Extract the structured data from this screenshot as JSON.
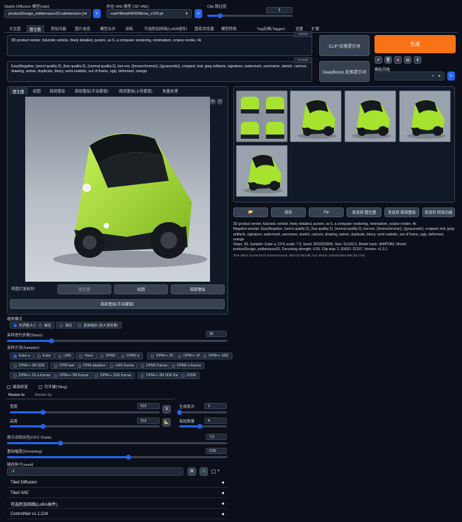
{
  "header": {
    "model_label": "Stable Diffusion 模型(ckpt)",
    "model_value": "productDesign_eddiemauro20.safetensors [db5",
    "vae_label": "外挂 VAE 模型 (SD VAE)",
    "vae_value": "vaeFtMse840000Ema_v100.pt",
    "clip_label": "Clip 跳过层",
    "clip_value": "2",
    "clip_fraction": 0.15
  },
  "tabs": [
    "文生图",
    "图生图",
    "附加功能",
    "图片信息",
    "模型合并",
    "训练",
    "可选附加网络(LoRA插件)",
    "图库浏览器",
    "模型转换",
    "Tag反推(Tagger)",
    "设置",
    "扩展"
  ],
  "active_tab": 1,
  "prompt": {
    "positive": "3D product render, futuristic vehicle, finely detailed, purism, ue 5, a computer rendering, minimalism, octane render, 4k",
    "positive_count": "12/150",
    "negative": "EasyNegative, (worst quality:2), (low quality:2), (normal quality:2), low-res, ((monochrome)), ((grayscale)), cropped, text, jpeg artifacts, signature, watermark, username, sketch, cartoon, drawing, anime, duplicate, blurry, semi-realistic, out of frame, ugly, deformed, orange",
    "negative_count": "57/150"
  },
  "actions": {
    "clip_btn": "CLIP 反推提示词",
    "deepbooru_btn": "DeepBooru 反推提示词",
    "generate": "生成",
    "style_label": "模板风格",
    "tool_icons": [
      "check-icon",
      "trash-icon",
      "palette-icon",
      "clipboard-icon",
      "save-style-icon"
    ]
  },
  "subtabs": [
    "图生图",
    "绘图",
    "局部重绘",
    "局部重绘(手涂蒙版)",
    "局部重绘(上传蒙版)",
    "批量处理"
  ],
  "copy": {
    "label": "将图片复制到",
    "btn1": "图生图",
    "btn2": "绘图",
    "btn3": "局部重绘",
    "btn4": "局部重绘(手涂蒙版)"
  },
  "resize": {
    "label": "缩放模式",
    "options": [
      "仅调整大小",
      "裁剪",
      "填充",
      "直接缩放 (放大潜变量)"
    ],
    "selected": 0
  },
  "steps": {
    "label": "采样迭代步数(Steps)",
    "value": "30",
    "fraction": 0.2
  },
  "sampler": {
    "label": "采样方法(Sampler)",
    "options": [
      "Euler a",
      "Euler",
      "LMS",
      "Heun",
      "DPM2",
      "DPM2 a",
      "DPM++ 2S a",
      "DPM++ 2M",
      "DPM++ SDE",
      "DPM++ 2M SDE",
      "DPM fast",
      "DPM adaptive",
      "LMS Karras",
      "DPM2 Karras",
      "DPM2 a Karras",
      "DPM++ 2S a Karras",
      "DPM++ 2M Karras",
      "DPM++ SDE Karras",
      "DPM++ 2M SDE Karras",
      "DDIM"
    ],
    "selected": 0
  },
  "checks": {
    "restore": "面部修复",
    "tiling": "可平铺(Tiling)"
  },
  "size_tabs": [
    "Resize to",
    "Resize by"
  ],
  "width": {
    "label": "宽度",
    "value": "512",
    "fraction": 0.22
  },
  "height": {
    "label": "高度",
    "value": "512",
    "fraction": 0.22
  },
  "batch_count": {
    "label": "生成批次",
    "value": "1",
    "fraction": 0.0
  },
  "batch_size": {
    "label": "每批数量",
    "value": "4",
    "fraction": 0.43
  },
  "cfg": {
    "label": "提示词相关性(CFG Scale)",
    "value": "7.5",
    "fraction": 0.24
  },
  "denoise": {
    "label": "重绘幅度(Denoising)",
    "value": "0.55",
    "fraction": 0.55
  },
  "seed": {
    "label": "随机种子(seed)",
    "value": "-1"
  },
  "accordions": [
    "Tiled Diffusion",
    "Tiled VAE",
    "可选附加网络(LoRA插件)",
    "ControlNet v1.1.224"
  ],
  "output": {
    "buttons": [
      "folder-icon",
      "保存",
      "Zip",
      "发送到 图生图",
      "发送到 局部重绘",
      "发送到 附加功能"
    ],
    "info": "3D product render, futuristic vehicle, finely detailed, purism, ue 5, a computer rendering, minimalism, octane render, 4k\nNegative prompt: EasyNegative, (worst quality:2), (low quality:2), (normal quality:2), low-res, ((monochrome)), ((grayscale)), cropped, text, jpeg artifacts, signature, watermark, username, sketch, cartoon, drawing, anime, duplicate, blurry, semi-realistic, out of frame, ugly, deformed, orange\nSteps: 30, Sampler: Euler a, CFG scale: 7.5, Seed: 3033203809, Size: 512x512, Model hash: db5ff7060, Model: productDesign_eddiemauro20, Denoising strength: 0.55, Clip skip: 2, ENSD: 31337, Version: v1.3.1",
    "time": "Time taken: 51.84sTorch active/reserved: 3561/11780 MiB, Sys VRAM: 13440/24564 MiB (54.71%)"
  },
  "colors": {
    "accent": "#2563eb",
    "generate": "#f97316",
    "bg": "#0b0f19",
    "car_green": "#a6e22e"
  }
}
